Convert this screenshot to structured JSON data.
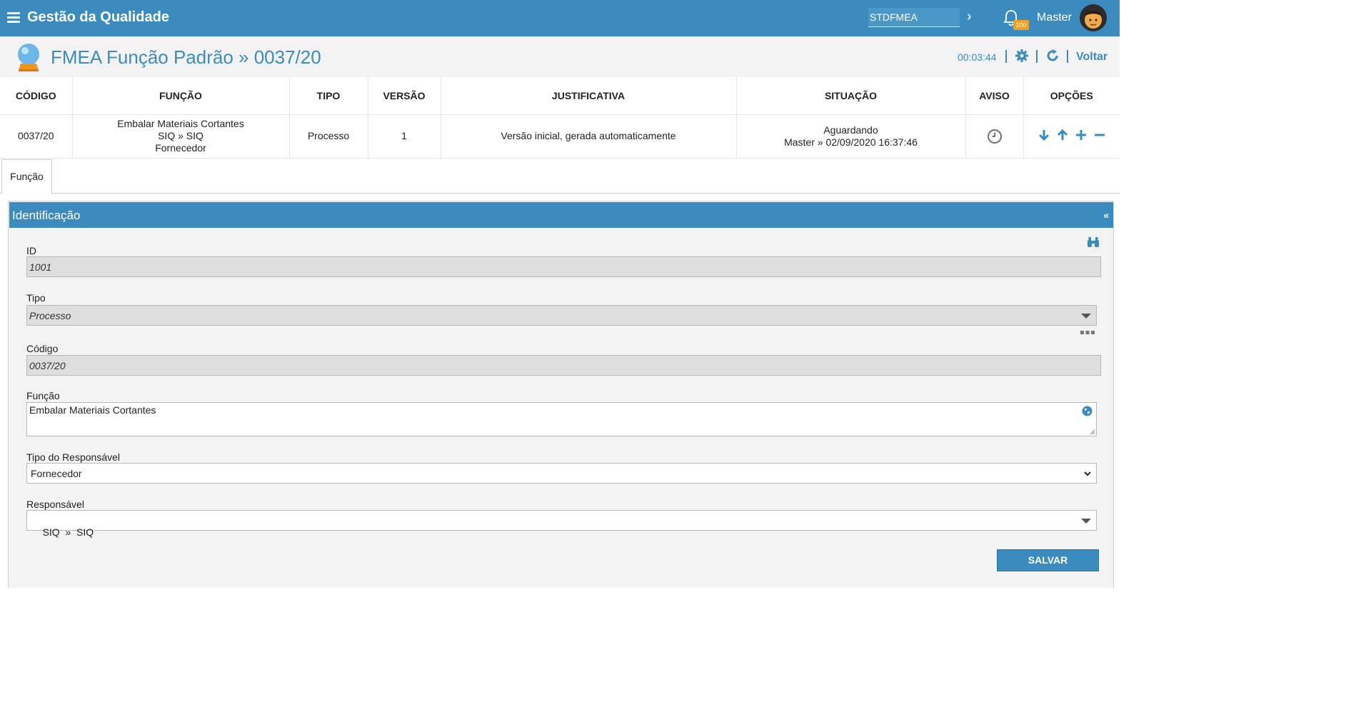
{
  "header": {
    "app_title": "Gestão da Qualidade",
    "module_input_value": "STDFMEA",
    "notification_count": "100",
    "user_name": "Master",
    "brand_color": "#3b8bbf",
    "badge_color": "#f0a020"
  },
  "titlebar": {
    "page_title": "FMEA Função Padrão » 0037/20",
    "timer": "00:03:44",
    "back_label": "Voltar"
  },
  "table": {
    "headers": [
      "CÓDIGO",
      "FUNÇÃO",
      "TIPO",
      "VERSÃO",
      "JUSTIFICATIVA",
      "SITUAÇÃO",
      "AVISO",
      "OPÇÕES"
    ],
    "row": {
      "codigo": "0037/20",
      "funcao_line1": "Embalar Materiais Cortantes",
      "funcao_line2": "SIQ » SIQ",
      "funcao_line3": "Fornecedor",
      "tipo": "Processo",
      "versao": "1",
      "justificativa": "Versão inicial, gerada automaticamente",
      "situacao_line1": "Aguardando",
      "situacao_line2": "Master » 02/09/2020 16:37:46"
    }
  },
  "tabs": [
    {
      "label": "Função"
    }
  ],
  "panel": {
    "title": "Identificação",
    "collapse_symbol": "«"
  },
  "form": {
    "id": {
      "label": "ID",
      "value": "1001"
    },
    "tipo": {
      "label": "Tipo",
      "value": "Processo"
    },
    "codigo": {
      "label": "Código",
      "value": "0037/20"
    },
    "funcao": {
      "label": "Função",
      "value": "Embalar Materiais Cortantes"
    },
    "tipo_responsavel": {
      "label": "Tipo do Responsável",
      "value": "Fornecedor"
    },
    "responsavel": {
      "label": "Responsável",
      "value": "SIQ  »  SIQ"
    },
    "save_label": "SALVAR"
  }
}
